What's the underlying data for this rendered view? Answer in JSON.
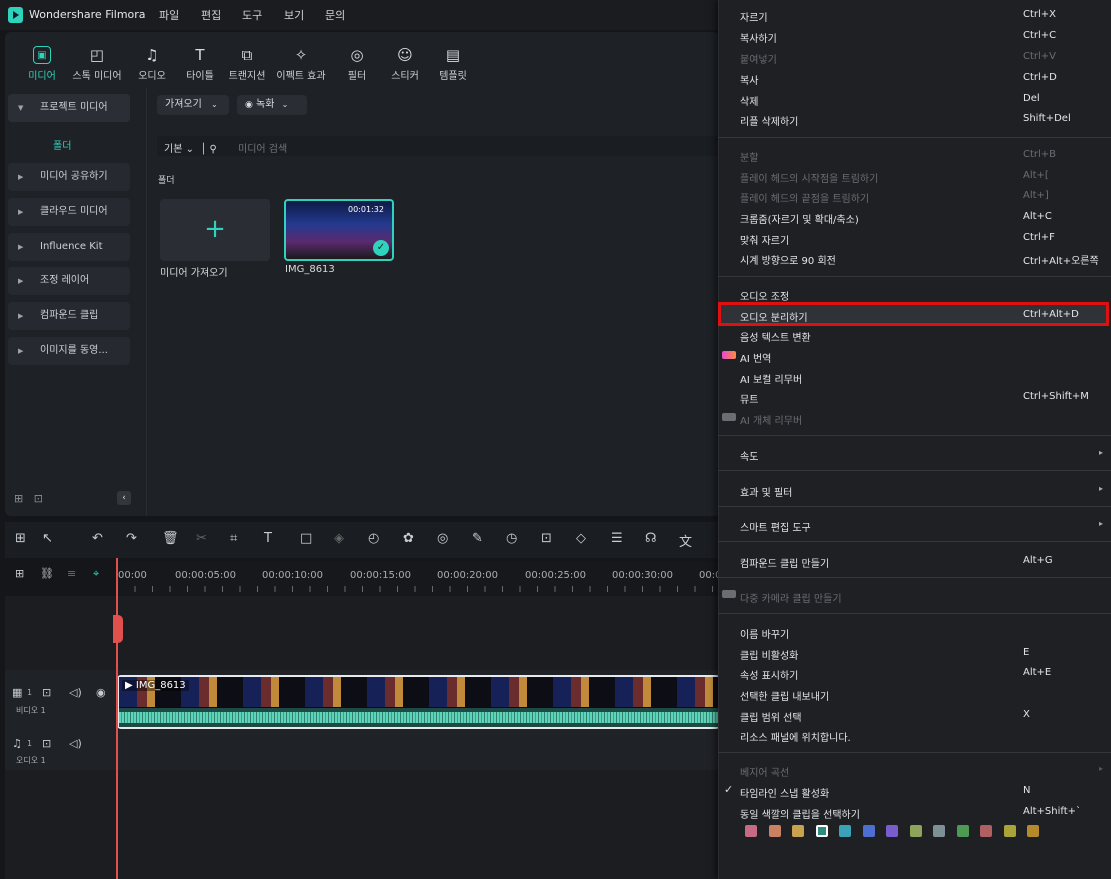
{
  "app": {
    "title": "Wondershare Filmora",
    "menus": [
      "파일",
      "편집",
      "도구",
      "보기",
      "문의"
    ]
  },
  "toolbar": {
    "items": [
      {
        "label": "미디어",
        "icon": "media-icon"
      },
      {
        "label": "스톡 미디어",
        "icon": "stock-icon"
      },
      {
        "label": "오디오",
        "icon": "music-icon"
      },
      {
        "label": "타이틀",
        "icon": "title-icon"
      },
      {
        "label": "트랜지션",
        "icon": "transition-icon"
      },
      {
        "label": "이펙트 효과",
        "icon": "effects-icon"
      },
      {
        "label": "필터",
        "icon": "filter-icon"
      },
      {
        "label": "스티커",
        "icon": "sticker-icon"
      },
      {
        "label": "템플릿",
        "icon": "template-icon"
      }
    ]
  },
  "sidebar": {
    "project_media": "프로젝트 미디어",
    "folder": "폴더",
    "items": [
      "미디어 공유하기",
      "클라우드 미디어",
      "Influence Kit",
      "조정 레이어",
      "컴파운드 클립",
      "이미지를 동영..."
    ]
  },
  "media": {
    "import_btn": "가져오기",
    "record_btn": "녹화",
    "sort": "기본",
    "search_placeholder": "미디어 검색",
    "section": "폴더",
    "add_label": "미디어 가져오기",
    "clip_name": "IMG_8613",
    "clip_duration": "00:01:32"
  },
  "timeline": {
    "ticks": [
      "00:00",
      "00:00:05:00",
      "00:00:10:00",
      "00:00:15:00",
      "00:00:20:00",
      "00:00:25:00",
      "00:00:30:00",
      "00:0"
    ],
    "video_track": "비디오 1",
    "audio_track": "오디오 1",
    "track_num": "1",
    "clip_name": "IMG_8613"
  },
  "context_menu": [
    {
      "label": "자르기",
      "key": "Ctrl+X"
    },
    {
      "label": "복사하기",
      "key": "Ctrl+C"
    },
    {
      "label": "붙여넣기",
      "key": "Ctrl+V",
      "disabled": true
    },
    {
      "label": "복사",
      "key": "Ctrl+D"
    },
    {
      "label": "삭제",
      "key": "Del"
    },
    {
      "label": "리플 삭제하기",
      "key": "Shift+Del"
    },
    {
      "label": "분할",
      "key": "Ctrl+B",
      "disabled": true
    },
    {
      "label": "플레이 헤드의 시작점을 트림하기",
      "key": "Alt+[",
      "disabled": true
    },
    {
      "label": "플레이 헤드의 끝점을 트림하기",
      "key": "Alt+]",
      "disabled": true
    },
    {
      "label": "크롭줌(자르기 및 확대/축소)",
      "key": "Alt+C"
    },
    {
      "label": "맞춰 자르기",
      "key": "Ctrl+F"
    },
    {
      "label": "시계 방향으로 90 회전",
      "key": "Ctrl+Alt+오른쪽"
    },
    {
      "label": "오디오 조정",
      "key": ""
    },
    {
      "label": "오디오 분리하기",
      "key": "Ctrl+Alt+D"
    },
    {
      "label": "음성 텍스트 변환",
      "key": ""
    },
    {
      "label": "AI 번역",
      "key": ""
    },
    {
      "label": "AI 보컬 리무버",
      "key": ""
    },
    {
      "label": "뮤트",
      "key": "Ctrl+Shift+M"
    },
    {
      "label": "AI 개체 리무버",
      "key": "",
      "disabled": true
    },
    {
      "label": "속도",
      "key": ""
    },
    {
      "label": "효과 및 필터",
      "key": ""
    },
    {
      "label": "스마트 편집 도구",
      "key": ""
    },
    {
      "label": "컴파운드 클립 만들기",
      "key": "Alt+G"
    },
    {
      "label": "다중 카메라 클립 만들기",
      "key": "",
      "disabled": true
    },
    {
      "label": "이름 바꾸기",
      "key": ""
    },
    {
      "label": "클립 비활성화",
      "key": "E"
    },
    {
      "label": "속성 표시하기",
      "key": "Alt+E"
    },
    {
      "label": "선택한 클립 내보내기",
      "key": ""
    },
    {
      "label": "클립 범위 선택",
      "key": "X"
    },
    {
      "label": "리소스 패널에 위치합니다.",
      "key": ""
    },
    {
      "label": "베지어 곡선",
      "key": "",
      "disabled": true
    },
    {
      "label": "타임라인 스냅 활성화",
      "key": "N"
    },
    {
      "label": "동일 색깔의 클립을 선택하기",
      "key": "Alt+Shift+`"
    }
  ],
  "colors": [
    "#c56b83",
    "#c98063",
    "#c9a24f",
    "#2e8c80",
    "#3aa3b8",
    "#4f6ed1",
    "#7a5ccf",
    "#8fa35a",
    "#7f8f96",
    "#4f9a52",
    "#b06060",
    "#a9a33a",
    "#b58a2a"
  ]
}
